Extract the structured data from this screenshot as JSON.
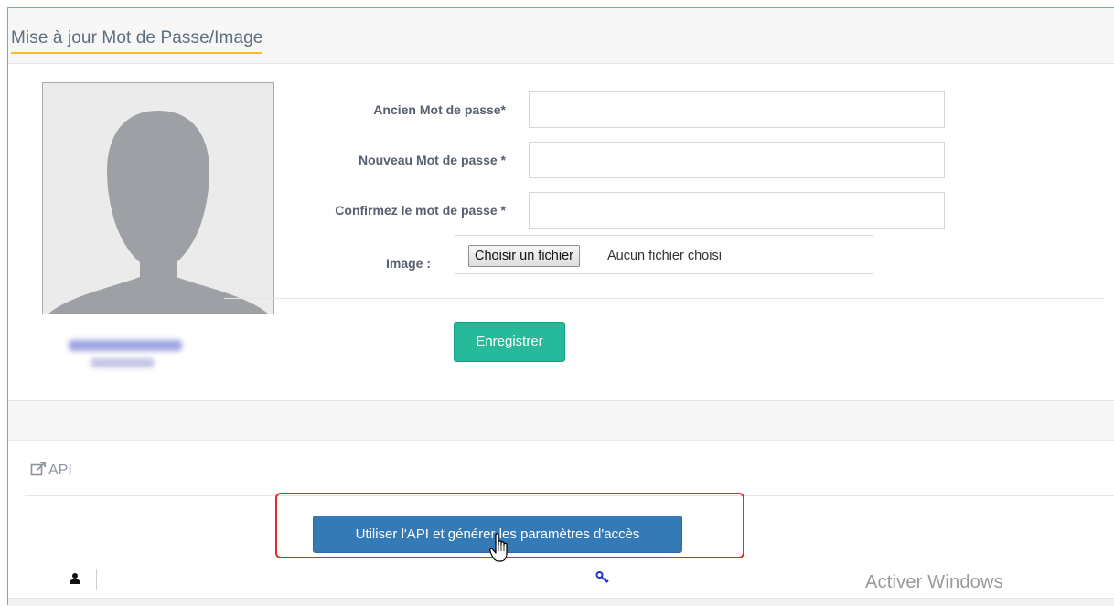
{
  "header": {
    "title": "Mise à jour Mot de Passe/Image"
  },
  "profile": {
    "avatar_icon": "user-silhouette-icon"
  },
  "form": {
    "old_password_label": "Ancien Mot de passe*",
    "old_password_value": "",
    "new_password_label": "Nouveau Mot de passe *",
    "new_password_value": "",
    "confirm_password_label": "Confirmez le mot de passe *",
    "confirm_password_value": "",
    "image_label": "Image :",
    "file_button_label": "Choisir un fichier",
    "file_status": "Aucun fichier choisi",
    "save_label": "Enregistrer"
  },
  "api": {
    "title_icon": "external-link-icon",
    "title": "API",
    "generate_button_label": "Utiliser l'API et générer les paramètres d'accès",
    "table_icons": [
      "user-icon",
      "key-icon"
    ]
  },
  "watermark": "Activer Windows",
  "colors": {
    "primary": "#337ab7",
    "success": "#26b99a",
    "highlight": "#e8262b",
    "title_underline": "#f0c21b"
  }
}
